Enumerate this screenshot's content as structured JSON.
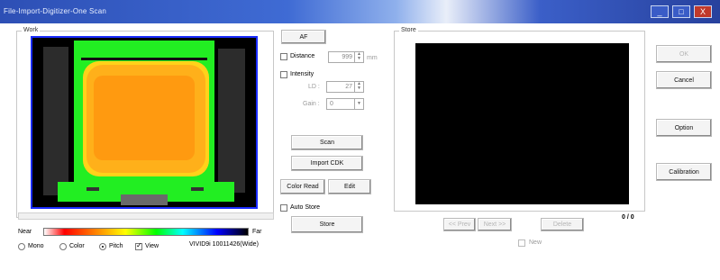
{
  "window": {
    "title": "File-Import-Digitizer-One Scan",
    "controls": [
      "_",
      "□",
      "X"
    ]
  },
  "work_panel": {
    "label": "Work",
    "scale_near": "Near",
    "scale_far": "Far",
    "options": [
      {
        "label": "Mono",
        "type": "radio",
        "checked": false
      },
      {
        "label": "Color",
        "type": "radio",
        "checked": false
      },
      {
        "label": "Pitch",
        "type": "radio",
        "checked": true
      },
      {
        "label": "View",
        "type": "checkbox",
        "checked": true
      }
    ],
    "device_info": "VIVID9i 10011426(Wide)"
  },
  "middle_controls": {
    "af_label": "AF",
    "distance_label": "Distance",
    "distance_value": "999",
    "distance_unit": "mm",
    "intensity_label": "Intensity",
    "ld_label": "LD :",
    "ld_value": "27",
    "gain_label": "Gain :",
    "gain_value": "0",
    "scan_label": "Scan",
    "import_cdk_label": "Import CDK",
    "color_read_label": "Color Read",
    "edit_label": "Edit",
    "auto_store_label": "Auto Store",
    "store_label": "Store"
  },
  "store_panel": {
    "label": "Store",
    "prev_label": "<< Prev",
    "next_label": "Next >>",
    "delete_label": "Delete",
    "count": "0 / 0",
    "new_label": "New"
  },
  "right_buttons": {
    "ok_label": "OK",
    "cancel_label": "Cancel",
    "option_label": "Option",
    "calibration_label": "Calibration"
  },
  "colors": {
    "titlebar": "#2d4fb5",
    "scan_outer": "#22ee22",
    "scan_mid": "#ffd21a",
    "scan_inner": "#ff9a10",
    "frame_border": "#1a2cff"
  }
}
